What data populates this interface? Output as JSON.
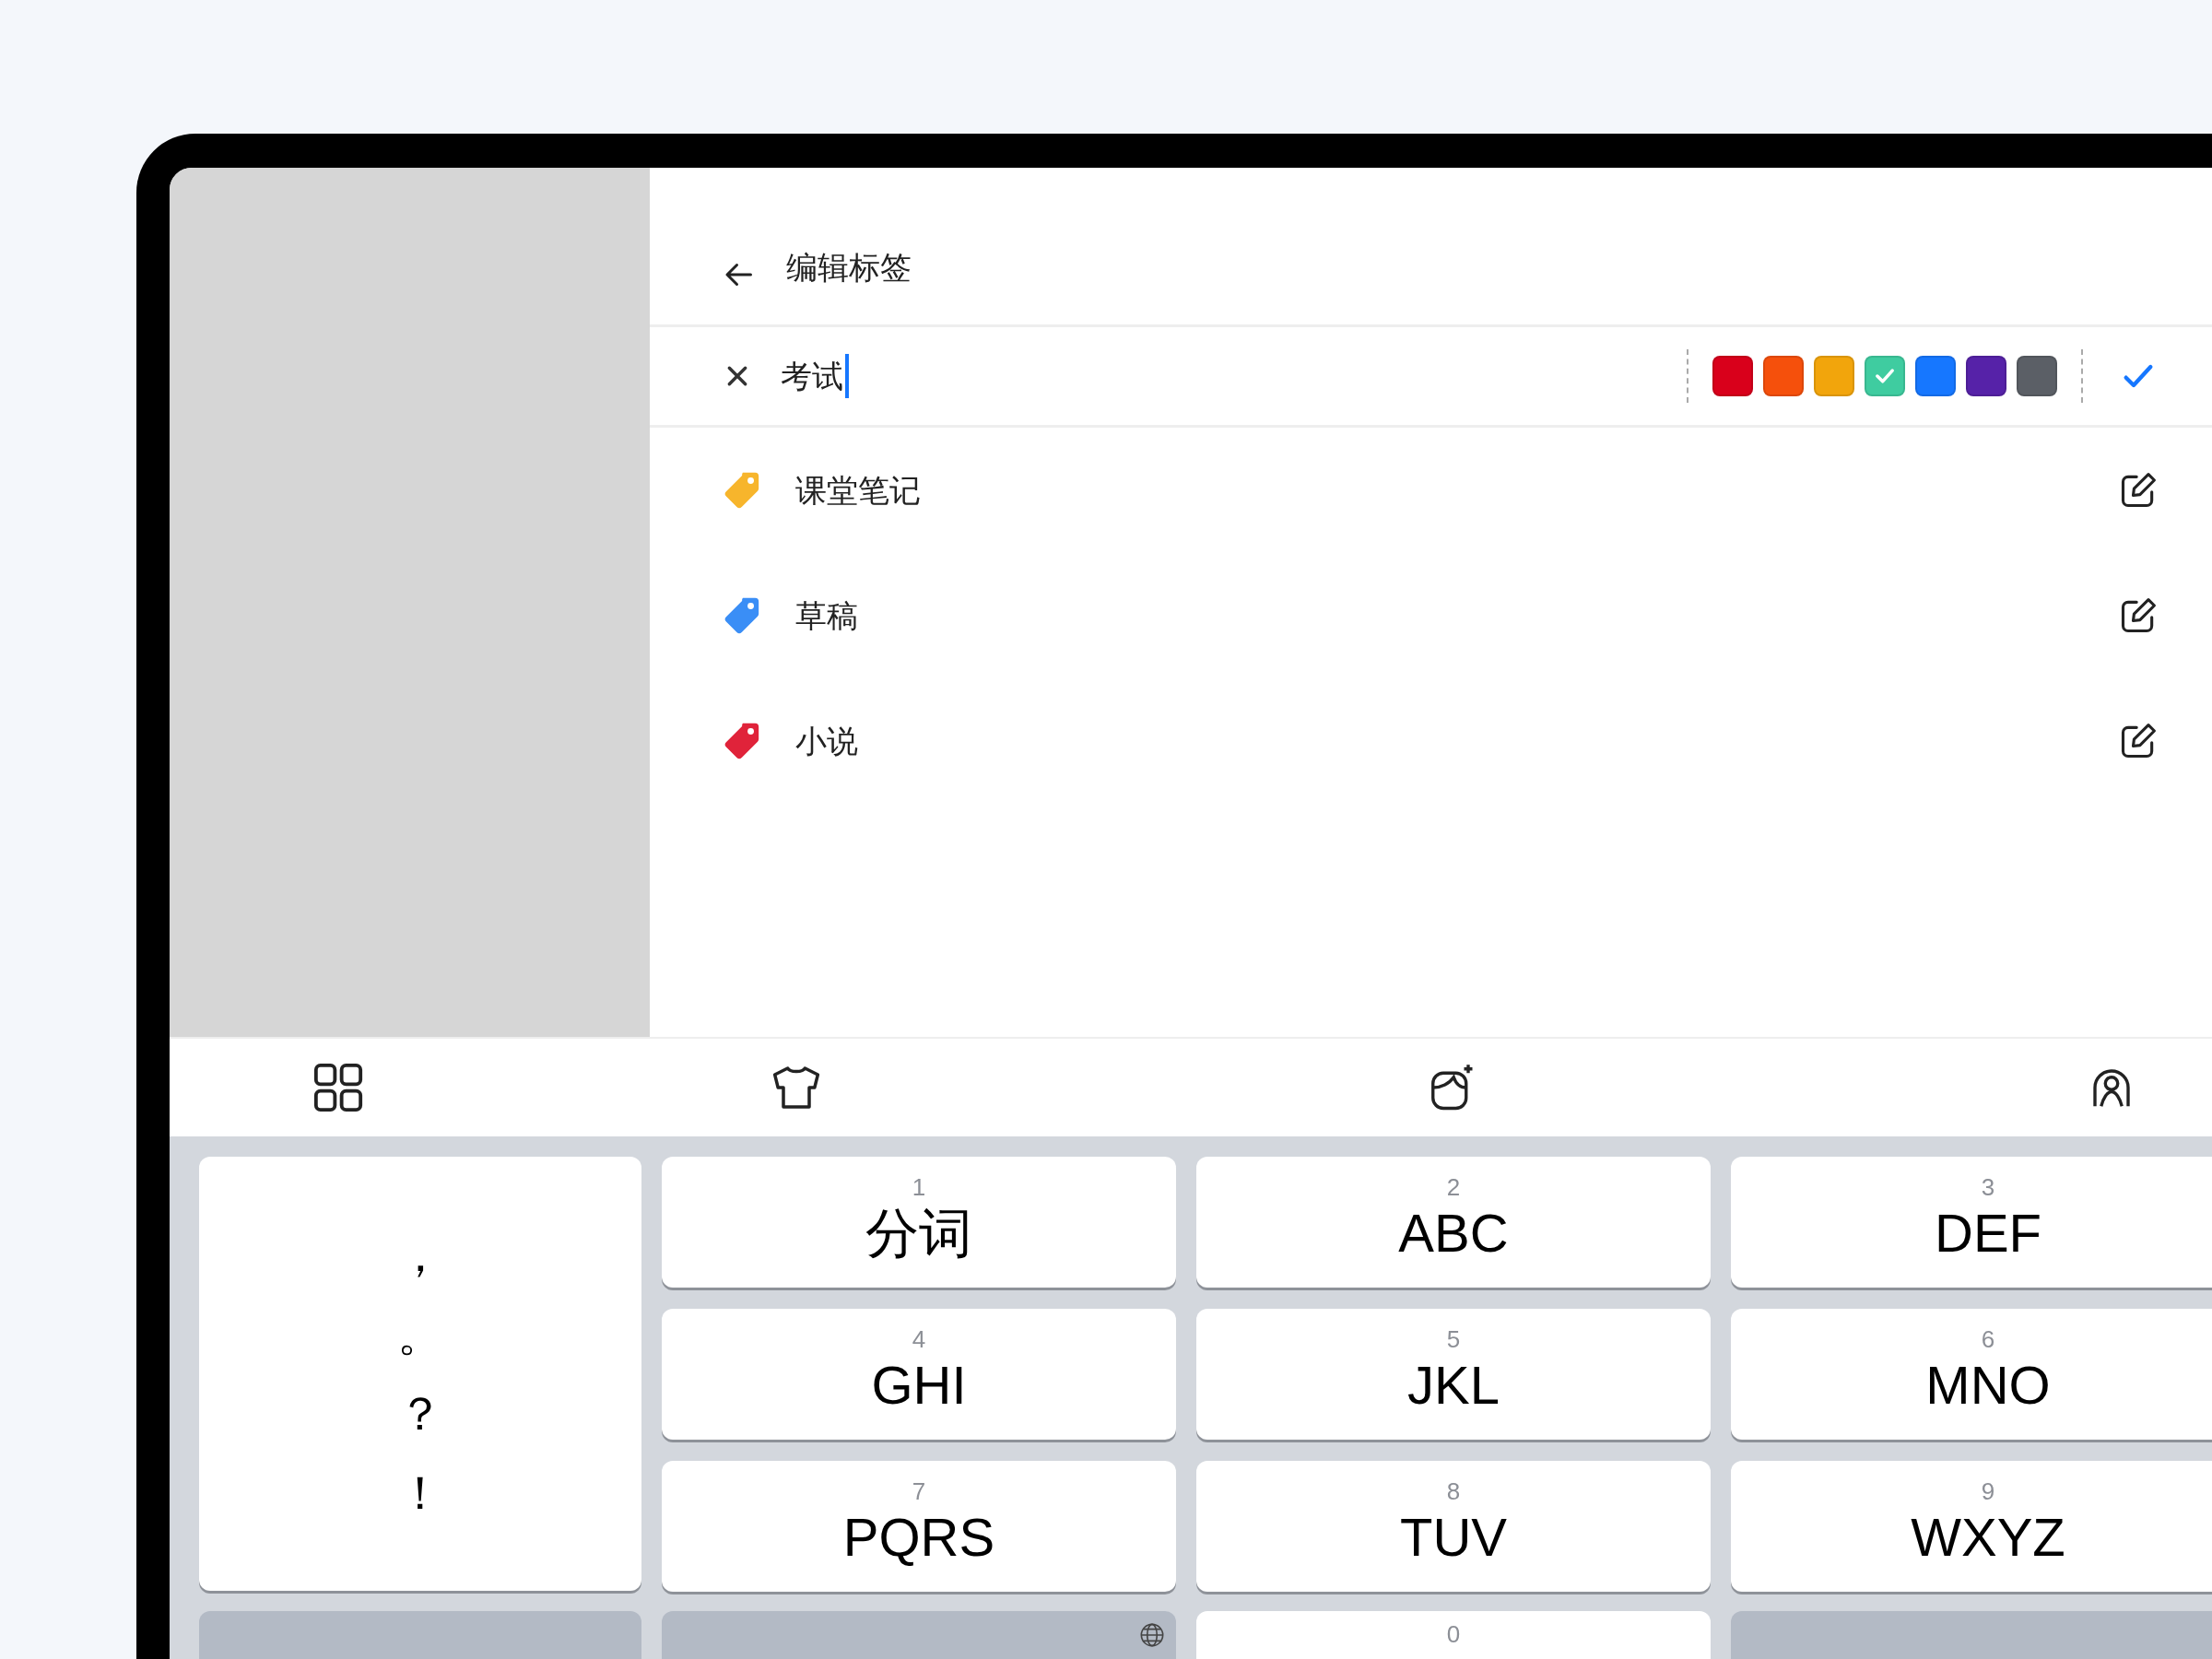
{
  "header": {
    "title": "编辑标签"
  },
  "editor": {
    "value": "考试",
    "swatches": [
      {
        "color": "#d9001b",
        "selected": false
      },
      {
        "color": "#f5500c",
        "selected": false
      },
      {
        "color": "#f2a50c",
        "selected": false
      },
      {
        "color": "#3fcca0",
        "selected": true
      },
      {
        "color": "#1677ff",
        "selected": false
      },
      {
        "color": "#5622a8",
        "selected": false
      },
      {
        "color": "#5b5f66",
        "selected": false
      }
    ]
  },
  "tags": [
    {
      "label": "课堂笔记",
      "color": "#f7b52c"
    },
    {
      "label": "草稿",
      "color": "#3a8ef6"
    },
    {
      "label": "小说",
      "color": "#e0233a"
    }
  ],
  "keyboard": {
    "punctuation": [
      "，",
      "。",
      "？",
      "！"
    ],
    "keys": [
      {
        "number": "1",
        "letters": "分词"
      },
      {
        "number": "2",
        "letters": "ABC"
      },
      {
        "number": "3",
        "letters": "DEF"
      },
      {
        "number": "4",
        "letters": "GHI"
      },
      {
        "number": "5",
        "letters": "JKL"
      },
      {
        "number": "6",
        "letters": "MNO"
      },
      {
        "number": "7",
        "letters": "PQRS"
      },
      {
        "number": "8",
        "letters": "TUV"
      },
      {
        "number": "9",
        "letters": "WXYZ"
      }
    ],
    "bottom_keys": [
      {
        "kind": "blank"
      },
      {
        "kind": "globe"
      },
      {
        "kind": "digit",
        "number": "0"
      },
      {
        "kind": "blank"
      }
    ]
  }
}
